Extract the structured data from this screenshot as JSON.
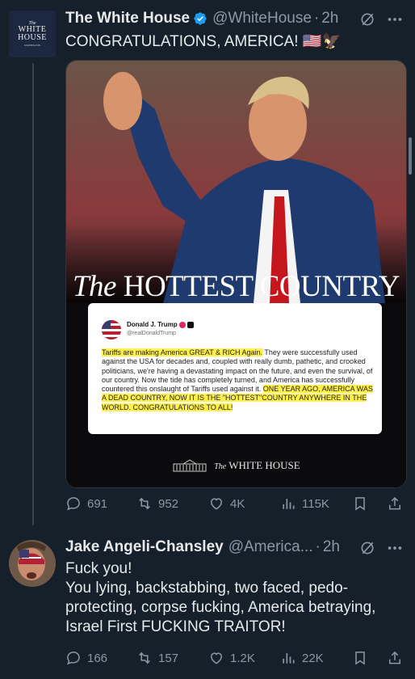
{
  "colors": {
    "background": "#15202b",
    "text": "#e7e9ea",
    "muted": "#8b98a5",
    "verified": "#1d9bf0",
    "highlight": "#fff04a"
  },
  "tweet1": {
    "avatar_text": {
      "top": "The",
      "line1": "WHITE",
      "line2": "HOUSE",
      "bottom": "WASHINGTON"
    },
    "name": "The White House",
    "handle": "@WhiteHouse",
    "separator": "·",
    "time": "2h",
    "text": "CONGRATULATIONS, AMERICA! 🇺🇸🦅",
    "media": {
      "headline_italic": "The",
      "headline_rest": "HOTTEST COUNTRY",
      "card": {
        "name": "Donald J. Trump",
        "handle": "@realDonaldTrump",
        "p1_highlight": "Tariffs are making America GREAT & RICH Again.",
        "p1_rest": " They were successfully used against the USA for decades and, coupled with really dumb, pathetic, and crooked politicians, we're having a devastating impact on the future, and even the survival, of our country. Now the tide has completely turned, and America has successfully countered this onslaught of Tariffs used against it. ",
        "p2_highlight": "ONE YEAR AGO, AMERICA WAS A DEAD COUNTRY, NOW IT IS THE \"HOTTEST\"COUNTRY ANYWHERE IN THE WORLD. CONGRATULATIONS TO ALL!"
      },
      "footer_italic": "The",
      "footer_rest": "WHITE HOUSE"
    },
    "actions": {
      "replies": "691",
      "reposts": "952",
      "likes": "4K",
      "views": "115K"
    }
  },
  "tweet2": {
    "name": "Jake Angeli-Chansley",
    "handle": "@America...",
    "separator": "·",
    "time": "2h",
    "lines": [
      "Fuck you!",
      "You lying, backstabbing, two faced, pedo-",
      "protecting, corpse fucking, America betraying,",
      "Israel First FUCKING TRAITOR!"
    ],
    "actions": {
      "replies": "166",
      "reposts": "157",
      "likes": "1.2K",
      "views": "22K"
    }
  },
  "icons": [
    "verified-icon",
    "grok-icon",
    "more-icon",
    "reply-icon",
    "repost-icon",
    "like-icon",
    "views-icon",
    "bookmark-icon",
    "share-icon"
  ]
}
